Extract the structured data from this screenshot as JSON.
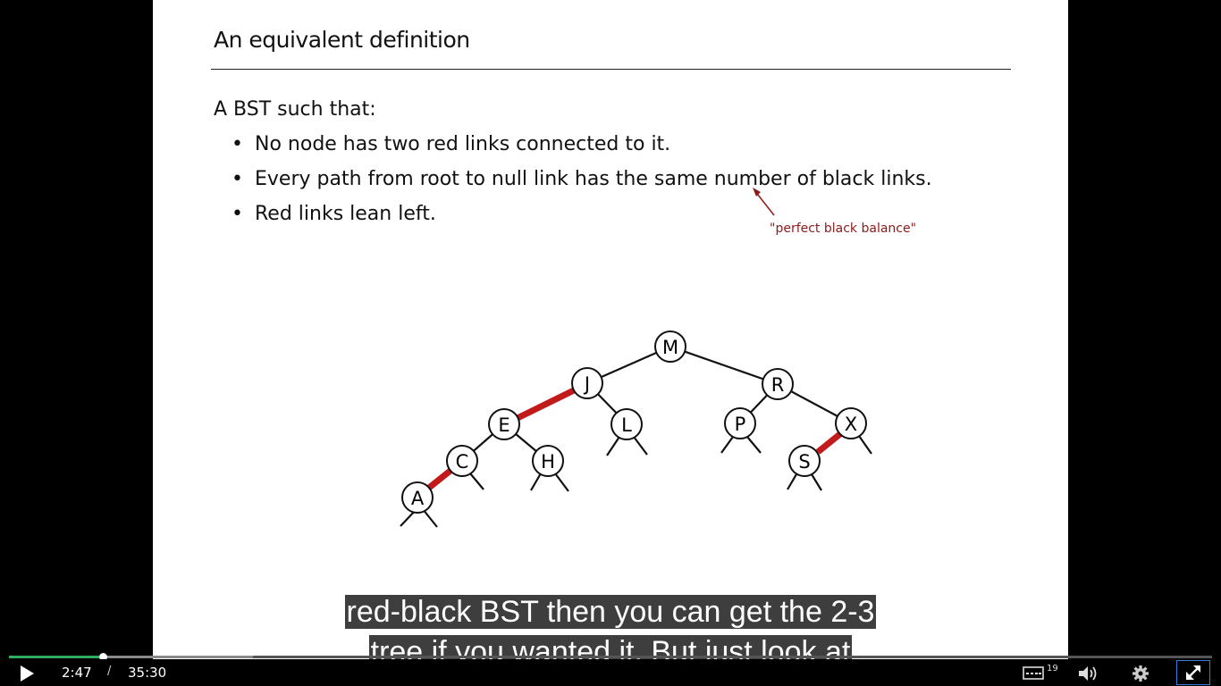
{
  "slide": {
    "title": "An equivalent definition",
    "lead": "A BST such that:",
    "bullets": [
      "No node has two red links connected to it.",
      "Every path from root to null link has the same number of black links.",
      "Red links lean left."
    ],
    "annotation": "\"perfect black balance\"",
    "colors": {
      "red_link": "#c21a1a",
      "annotation": "#8b1a1a"
    },
    "tree_nodes": [
      "M",
      "J",
      "R",
      "E",
      "L",
      "P",
      "X",
      "C",
      "H",
      "S",
      "A"
    ],
    "red_links": [
      [
        "J",
        "E"
      ],
      [
        "C",
        "A"
      ],
      [
        "X",
        "S"
      ]
    ]
  },
  "captions": {
    "line1": "red-black BST then you can get the 2-3",
    "line2": "tree if you wanted it. But just look at"
  },
  "player": {
    "state": "paused",
    "play_icon": "play-icon",
    "time_current": "2:47",
    "time_separator": "/",
    "time_duration": "35:30",
    "progress_fraction": 0.078,
    "buffered_fraction": 0.203,
    "cc_count": "19",
    "icons": [
      "closed-captions-icon",
      "volume-icon",
      "gear-icon",
      "exit-fullscreen-icon"
    ],
    "accent": "#2fae5f"
  }
}
